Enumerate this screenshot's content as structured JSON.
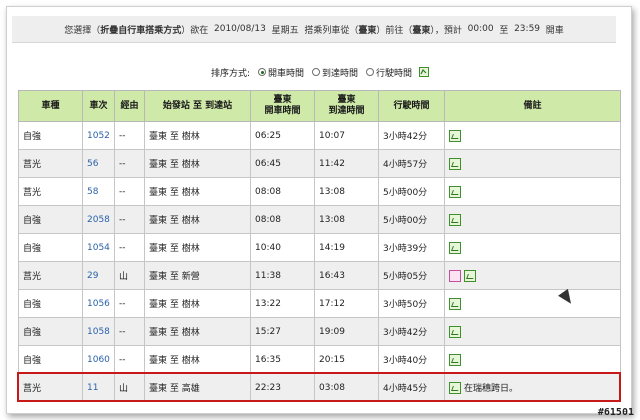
{
  "info": {
    "prefix": "您選擇（",
    "mode": "折疊自行車搭乘方式",
    "mid1": "）欲在  ",
    "date": "2010/08/13",
    "weekday": "星期五",
    "mid2": "搭乘列車從（",
    "from": "臺東",
    "mid3": "）前往（",
    "to": "臺東",
    "mid4": "），預計  ",
    "time_from": "00:00",
    "mid5": "至",
    "time_to": "23:59",
    "suffix": "開車"
  },
  "sort": {
    "label": "排序方式:",
    "options": [
      "開車時間",
      "到達時間",
      "行駛時間"
    ],
    "selected": "開車時間"
  },
  "table": {
    "headers": [
      "車種",
      "車次",
      "經由",
      "始發站 至 到達站",
      "臺東\n開車時間",
      "臺東\n到達時間",
      "行駛時間",
      "備註"
    ],
    "rows": [
      {
        "type": "自強",
        "no": "1052",
        "via": "--",
        "route": "臺東 至 樹林",
        "dep": "06:25",
        "arr": "10:07",
        "dur": "3小時42分",
        "note": ""
      },
      {
        "type": "莒光",
        "no": "56",
        "via": "--",
        "route": "臺東 至 樹林",
        "dep": "06:45",
        "arr": "11:42",
        "dur": "4小時57分",
        "note": ""
      },
      {
        "type": "莒光",
        "no": "58",
        "via": "--",
        "route": "臺東 至 樹林",
        "dep": "08:08",
        "arr": "13:08",
        "dur": "5小時00分",
        "note": ""
      },
      {
        "type": "自強",
        "no": "2058",
        "via": "--",
        "route": "臺東 至 樹林",
        "dep": "08:08",
        "arr": "13:08",
        "dur": "5小時00分",
        "note": ""
      },
      {
        "type": "自強",
        "no": "1054",
        "via": "--",
        "route": "臺東 至 樹林",
        "dep": "10:40",
        "arr": "14:19",
        "dur": "3小時39分",
        "note": ""
      },
      {
        "type": "莒光",
        "no": "29",
        "via": "山",
        "route": "臺東 至 新營",
        "dep": "11:38",
        "arr": "16:43",
        "dur": "5小時05分",
        "note": "pink"
      },
      {
        "type": "自強",
        "no": "1056",
        "via": "--",
        "route": "臺東 至 樹林",
        "dep": "13:22",
        "arr": "17:12",
        "dur": "3小時50分",
        "note": ""
      },
      {
        "type": "自強",
        "no": "1058",
        "via": "--",
        "route": "臺東 至 樹林",
        "dep": "15:27",
        "arr": "19:09",
        "dur": "3小時42分",
        "note": ""
      },
      {
        "type": "自強",
        "no": "1060",
        "via": "--",
        "route": "臺東 至 樹林",
        "dep": "16:35",
        "arr": "20:15",
        "dur": "3小時40分",
        "note": ""
      },
      {
        "type": "莒光",
        "no": "11",
        "via": "山",
        "route": "臺東 至 高雄",
        "dep": "22:23",
        "arr": "03:08",
        "dur": "4小時45分",
        "note": "在瑞穗跨日。"
      }
    ]
  },
  "watermark": "#61501",
  "colors": {
    "header_bg": "#cfe9a9",
    "highlight_border": "#c81919",
    "link": "#2b63a8"
  }
}
